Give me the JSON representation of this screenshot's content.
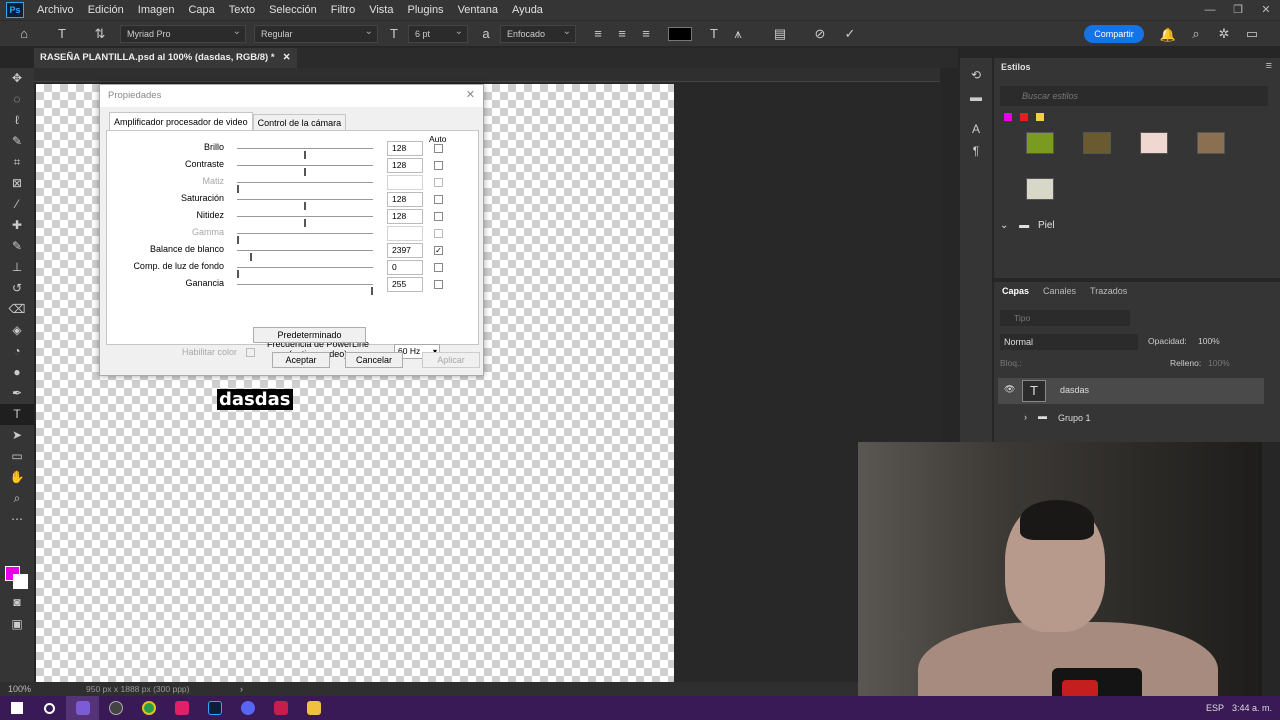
{
  "app": {
    "logo": "Ps",
    "menu": [
      "Archivo",
      "Edición",
      "Imagen",
      "Capa",
      "Texto",
      "Selección",
      "Filtro",
      "Vista",
      "Plugins",
      "Ventana",
      "Ayuda"
    ]
  },
  "options": {
    "font_family": "Myriad Pro",
    "font_style": "Regular",
    "font_size": "6 pt",
    "antialias": "Enfocado",
    "text_color": "#000000",
    "share_label": "Compartir"
  },
  "document": {
    "tab_title": "RASEÑA PLANTILLA.psd al 100% (dasdas, RGB/8) *",
    "text_layer_content": "dasdas",
    "zoom": "100%",
    "dimensions": "950 px x 1888 px (300 ppp)"
  },
  "colors": {
    "foreground": "#e600e6",
    "background": "#ffffff",
    "accent": "#1473e6"
  },
  "dialog": {
    "title": "Propiedades",
    "tabs": [
      "Amplificador procesador de video",
      "Control de la cámara"
    ],
    "auto_header": "Auto",
    "rows": [
      {
        "label": "Brillo",
        "value": "128",
        "level": 0.5,
        "auto": false,
        "enabled": true
      },
      {
        "label": "Contraste",
        "value": "128",
        "level": 0.5,
        "auto": false,
        "enabled": true
      },
      {
        "label": "Matiz",
        "value": "",
        "level": 0.0,
        "auto": false,
        "enabled": false
      },
      {
        "label": "Saturación",
        "value": "128",
        "level": 0.5,
        "auto": false,
        "enabled": true
      },
      {
        "label": "Nitidez",
        "value": "128",
        "level": 0.5,
        "auto": false,
        "enabled": true
      },
      {
        "label": "Gamma",
        "value": "",
        "level": 0.0,
        "auto": false,
        "enabled": false
      },
      {
        "label": "Balance de blanco",
        "value": "2397",
        "level": 0.1,
        "auto": true,
        "enabled": true
      },
      {
        "label": "Comp. de luz de fondo",
        "value": "0",
        "level": 0.0,
        "auto": false,
        "enabled": true
      },
      {
        "label": "Ganancia",
        "value": "255",
        "level": 1.0,
        "auto": false,
        "enabled": true
      }
    ],
    "enable_color_label": "Habilitar color",
    "powerline_label_1": "Frecuencia de PowerLine",
    "powerline_label_2": "(antiparpadeo)",
    "powerline_value": "60 Hz",
    "default_button": "Predeterminado",
    "ok_button": "Aceptar",
    "cancel_button": "Cancelar",
    "apply_button": "Aplicar"
  },
  "styles_panel": {
    "title": "Estilos",
    "search_placeholder": "Buscar estilos",
    "group_name": "Piel"
  },
  "layers_panel": {
    "tabs": [
      "Capas",
      "Canales",
      "Trazados"
    ],
    "filter_placeholder": "Tipo",
    "blend_mode": "Normal",
    "opacity_label": "Opacidad:",
    "opacity_value": "100%",
    "lock_label": "Bloq.:",
    "fill_label": "Relleno:",
    "fill_value": "100%",
    "layers": [
      {
        "name": "dasdas",
        "kind": "text"
      },
      {
        "name": "Grupo 1",
        "kind": "group"
      }
    ]
  },
  "taskbar": {
    "language": "ESP",
    "time": "3:44 a. m."
  }
}
